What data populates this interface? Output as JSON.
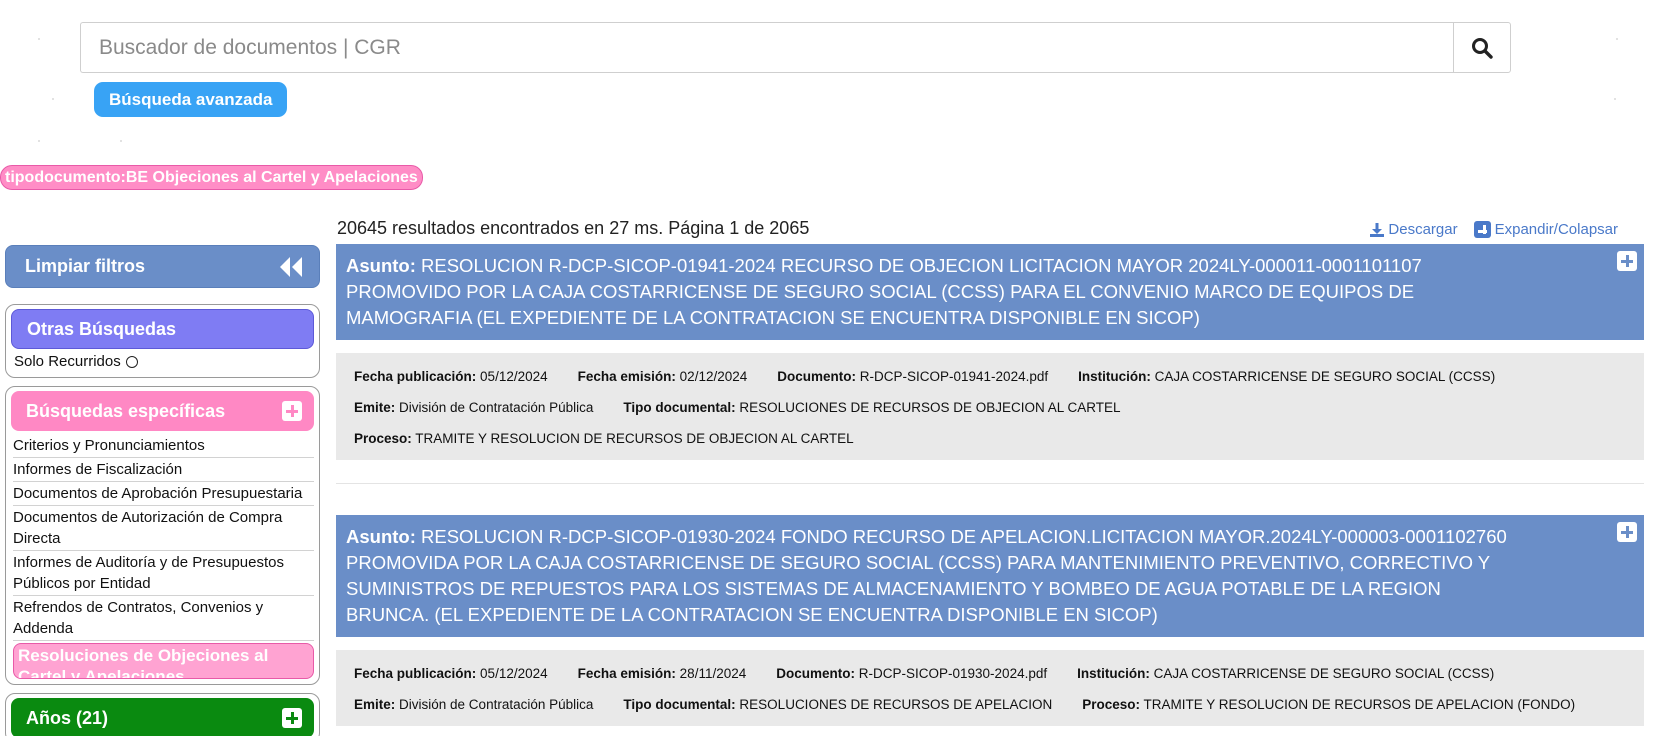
{
  "search": {
    "placeholder": "Buscador de documentos | CGR",
    "value": "",
    "advanced_label": "Búsqueda avanzada"
  },
  "active_filter": "tipodocumento:BE Objeciones al Cartel y Apelaciones",
  "sidebar": {
    "clear_filters": "Limpiar filtros",
    "otras": {
      "title": "Otras Búsquedas",
      "solo_recurridos": "Solo Recurridos"
    },
    "especificas": {
      "title": "Búsquedas específicas",
      "items": [
        "Criterios y Pronunciamientos",
        "Informes de Fiscalización",
        "Documentos de Aprobación Presupuestaria",
        "Documentos de Autorización de Compra Directa",
        "Informes de Auditoría y de Presupuestos Públicos por Entidad",
        "Refrendos de Contratos, Convenios y Addenda",
        "Resoluciones de Objeciones al Cartel y Apelaciones"
      ]
    },
    "anos": {
      "title": "Años (21)"
    }
  },
  "results": {
    "summary": "20645 resultados encontrados en 27 ms. Página 1 de 2065",
    "download_label": "Descargar",
    "expand_label": "Expandir/Colapsar",
    "labels": {
      "asunto": "Asunto:",
      "fecha_publicacion": "Fecha publicación:",
      "fecha_emision": "Fecha emisión:",
      "documento": "Documento:",
      "institucion": "Institución:",
      "emite": "Emite:",
      "tipo_documental": "Tipo documental:",
      "proceso": "Proceso:"
    },
    "items": [
      {
        "asunto": "RESOLUCION R-DCP-SICOP-01941-2024 RECURSO DE OBJECION LICITACION MAYOR 2024LY-000011-0001101107 PROMOVIDO POR LA CAJA COSTARRICENSE DE SEGURO SOCIAL (CCSS) PARA EL CONVENIO MARCO DE EQUIPOS DE MAMOGRAFIA (EL EXPEDIENTE DE LA CONTRATACION SE ENCUENTRA DISPONIBLE EN SICOP)",
        "fecha_publicacion": "05/12/2024",
        "fecha_emision": "02/12/2024",
        "documento": "R-DCP-SICOP-01941-2024.pdf",
        "institucion": "CAJA COSTARRICENSE DE SEGURO SOCIAL (CCSS)",
        "emite": "División de Contratación Pública",
        "tipo_documental": "RESOLUCIONES DE RECURSOS DE OBJECION AL CARTEL",
        "proceso": "TRAMITE Y RESOLUCION DE RECURSOS DE OBJECION AL CARTEL"
      },
      {
        "asunto": "RESOLUCION R-DCP-SICOP-01930-2024 FONDO RECURSO DE APELACION.LICITACION MAYOR.2024LY-000003-0001102760 PROMOVIDA POR LA CAJA COSTARRICENSE DE SEGURO SOCIAL (CCSS) PARA MANTENIMIENTO PREVENTIVO, CORRECTIVO Y SUMINISTROS DE REPUESTOS PARA LOS SISTEMAS DE ALMACENAMIENTO Y BOMBEO DE AGUA POTABLE DE LA REGION BRUNCA. (EL EXPEDIENTE DE LA CONTRATACION SE ENCUENTRA DISPONIBLE EN SICOP)",
        "fecha_publicacion": "05/12/2024",
        "fecha_emision": "28/11/2024",
        "documento": "R-DCP-SICOP-01930-2024.pdf",
        "institucion": "CAJA COSTARRICENSE DE SEGURO SOCIAL (CCSS)",
        "emite": "División de Contratación Pública",
        "tipo_documental": "RESOLUCIONES DE RECURSOS DE APELACION",
        "proceso": "TRAMITE Y RESOLUCION DE RECURSOS DE APELACION (FONDO)"
      }
    ]
  },
  "colors": {
    "accent_blue": "#6a8ec8",
    "button_blue": "#38a3f5",
    "pink": "#ff88c4",
    "purple": "#7f7cf3",
    "green": "#0a8a10",
    "link_blue": "#4a79c9"
  },
  "icons": [
    "search-icon",
    "double-chevron-left-icon",
    "plus-icon",
    "download-icon",
    "radio-icon"
  ]
}
